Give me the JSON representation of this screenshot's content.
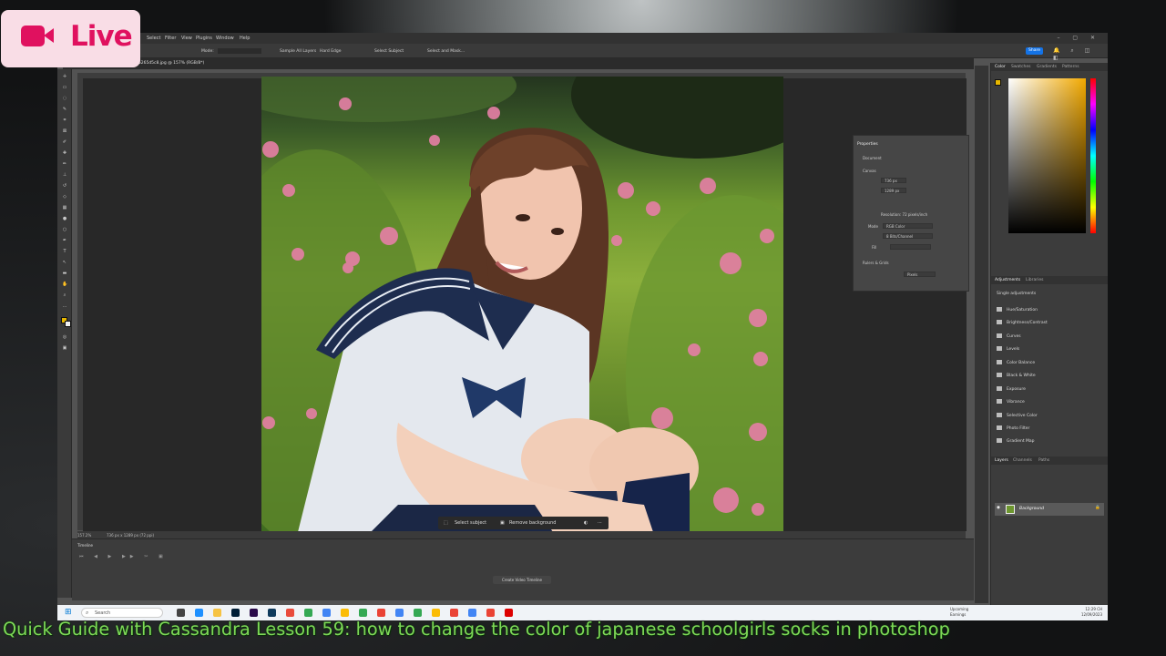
{
  "live_badge": {
    "label": "Live",
    "icon": "video-camera-icon"
  },
  "caption": "Quick Guide with Cassandra Lesson 59: how to change the color of japanese schoolgirls socks in photoshop",
  "menubar": {
    "items": [
      "Select",
      "Filter",
      "View",
      "Plugins",
      "Window",
      "Help"
    ]
  },
  "options_bar": {
    "mode": "Mode:",
    "sample_all_layers": "Sample All Layers",
    "hard_edge": "Hard Edge",
    "select_subject": "Select Subject",
    "select_and_mask": "Select and Mask...",
    "share": "Share"
  },
  "document_tab": {
    "title": "35265d5c8.jpg @ 157% (RGB/8*)"
  },
  "context_bar": {
    "select_subject": "Select subject",
    "remove_background": "Remove background"
  },
  "status_bar": {
    "zoom": "157.2%",
    "size": "736 px x 1289 px (72 ppi)"
  },
  "timeline": {
    "title": "Timeline",
    "create_button": "Create Video Timeline"
  },
  "properties_panel": {
    "title": "Properties",
    "document_label": "Document",
    "canvas_section": "Canvas",
    "width": "736 px",
    "height": "1289 px",
    "resolution": "Resolution: 72 pixels/inch",
    "mode_label": "Mode",
    "mode_value": "RGB Color",
    "bits": "8 Bits/Channel",
    "fill_label": "Fill",
    "rulers_section": "Rulers & Grids",
    "units": "Pixels"
  },
  "right_panels": {
    "color_tabs": [
      "Color",
      "Swatches",
      "Gradients",
      "Patterns"
    ],
    "adjust_tabs": [
      "Adjustments",
      "Libraries"
    ],
    "single_adjustments": "Single adjustments",
    "adjustments": [
      "Hue/Saturation",
      "Brightness/Contrast",
      "Curves",
      "Levels",
      "Color Balance",
      "Black & White",
      "Exposure",
      "Vibrance",
      "Selective Color",
      "Photo Filter",
      "Gradient Map"
    ],
    "layer_tabs": [
      "Layers",
      "Channels",
      "Paths"
    ],
    "layer_name": "Background"
  },
  "taskbar": {
    "search_placeholder": "Search",
    "weather_title": "Upcoming",
    "weather_sub": "Earnings",
    "time": "12:29 CH",
    "date": "12/09/2023"
  },
  "colors": {
    "accent": "#1473e6",
    "foreground": "#e8b800",
    "live": "#e0115f",
    "caption": "#7ed957"
  }
}
